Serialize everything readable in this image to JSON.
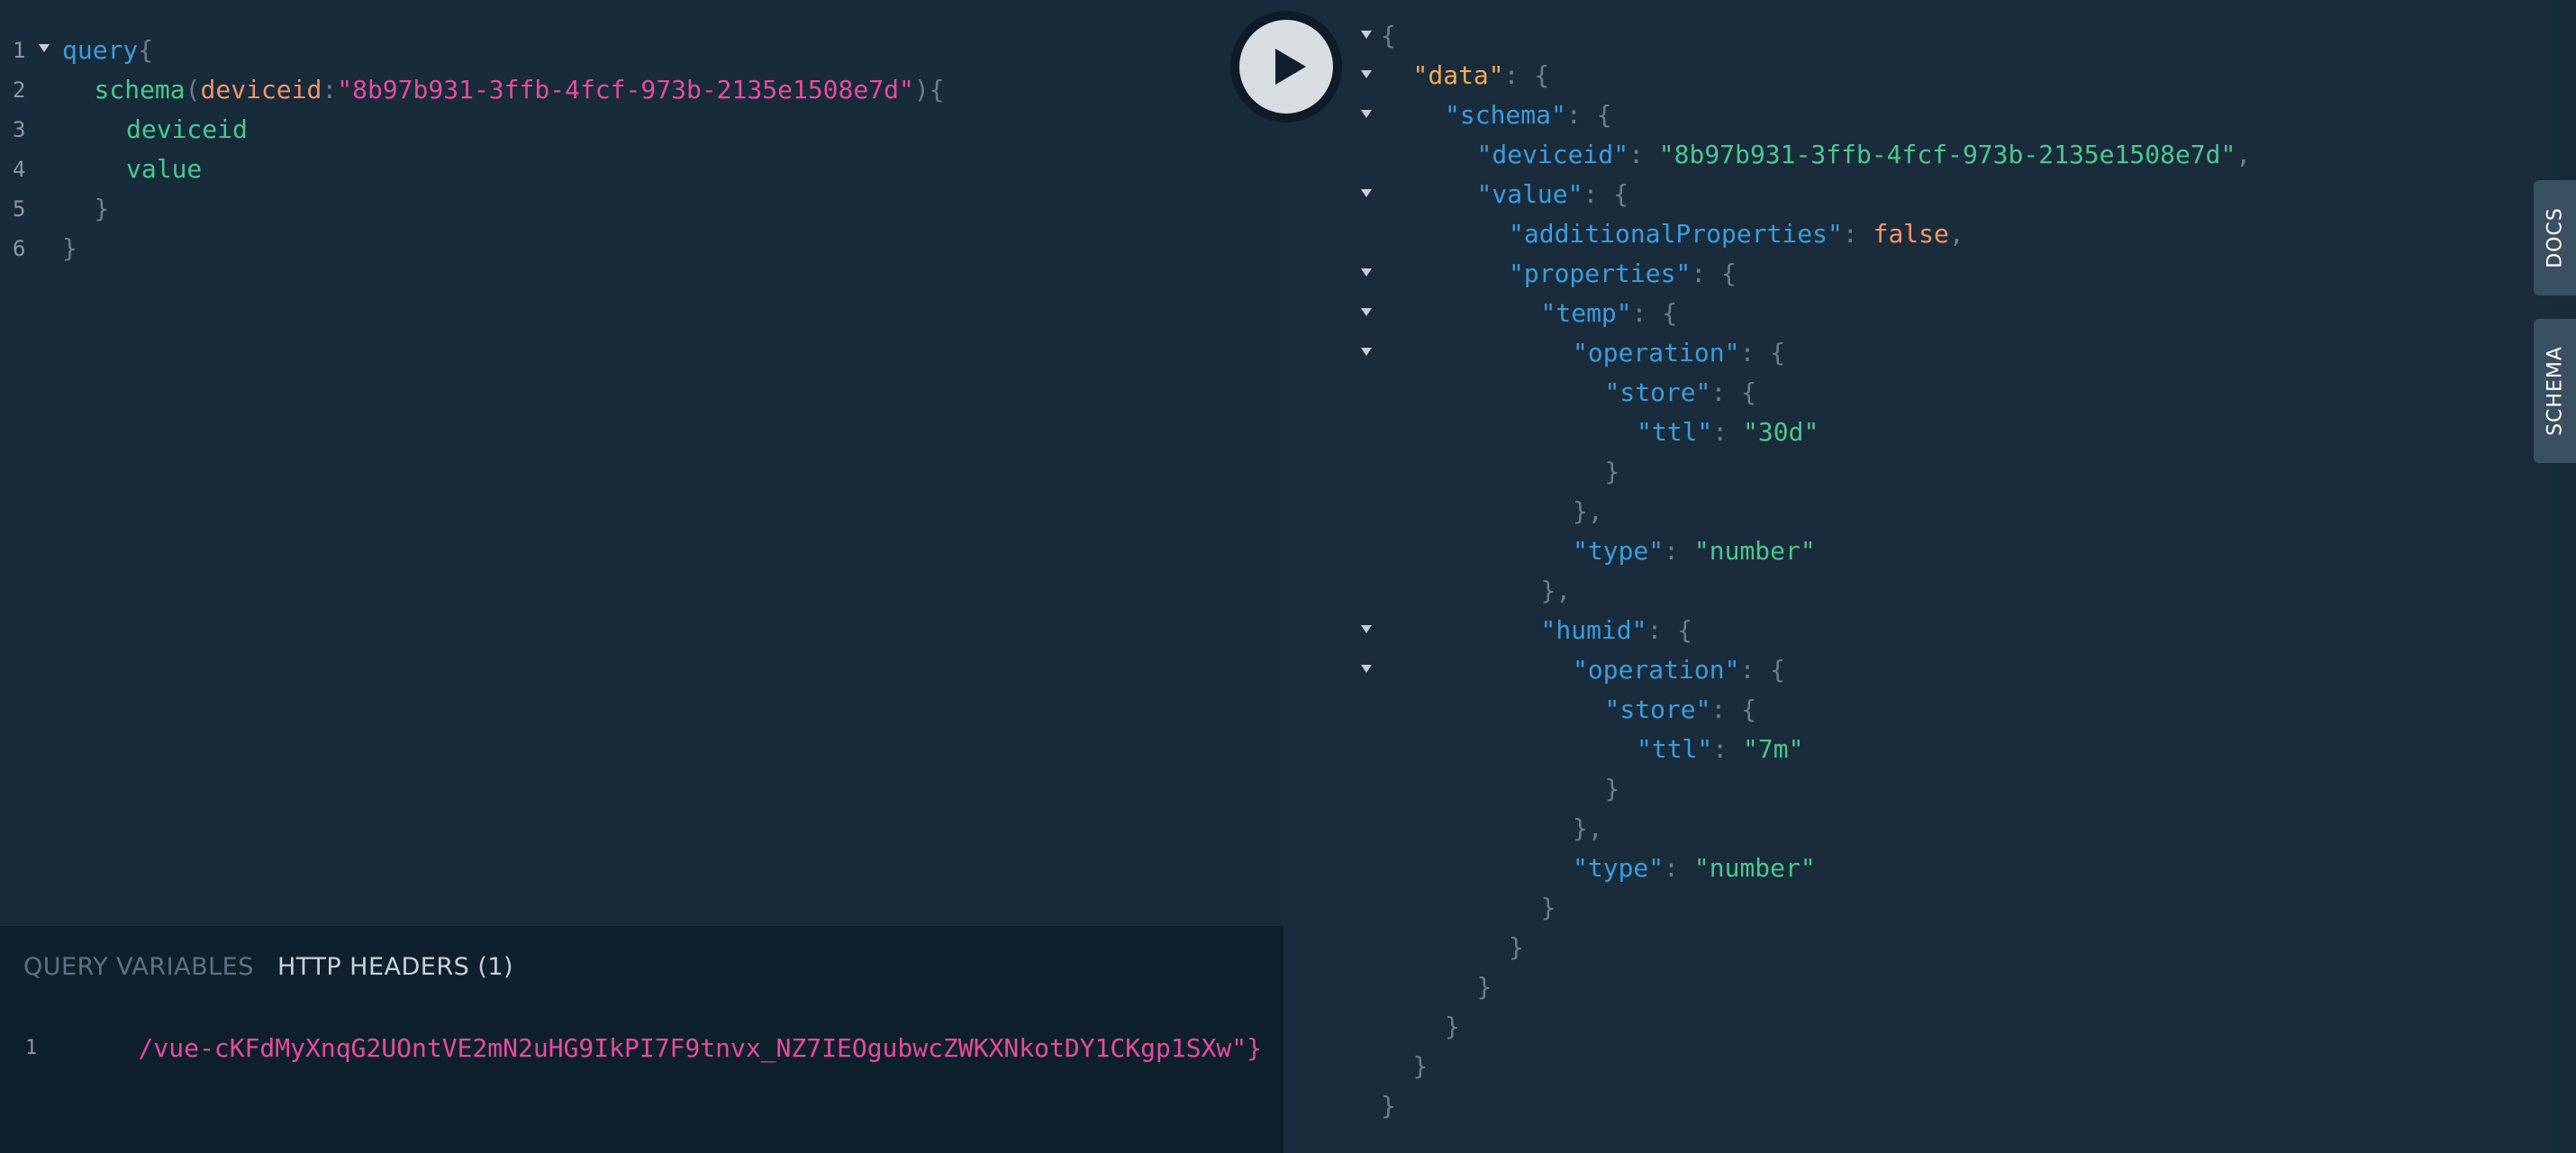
{
  "editor": {
    "lines": [
      {
        "num": "1",
        "fold": true,
        "indent": 0,
        "tokens": [
          {
            "t": "query",
            "c": "keyword"
          },
          {
            "t": "{",
            "c": "punct"
          }
        ]
      },
      {
        "num": "2",
        "fold": false,
        "indent": 1,
        "tokens": [
          {
            "t": "schema",
            "c": "field"
          },
          {
            "t": "(",
            "c": "punct"
          },
          {
            "t": "deviceid",
            "c": "arg"
          },
          {
            "t": ":",
            "c": "punct"
          },
          {
            "t": "\"8b97b931-3ffb-4fcf-973b-2135e1508e7d\"",
            "c": "str"
          },
          {
            "t": "){",
            "c": "punct"
          }
        ]
      },
      {
        "num": "3",
        "fold": false,
        "indent": 2,
        "tokens": [
          {
            "t": "deviceid",
            "c": "field"
          }
        ]
      },
      {
        "num": "4",
        "fold": false,
        "indent": 2,
        "tokens": [
          {
            "t": "value",
            "c": "field"
          }
        ]
      },
      {
        "num": "5",
        "fold": false,
        "indent": 1,
        "tokens": [
          {
            "t": "}",
            "c": "punct"
          }
        ]
      },
      {
        "num": "6",
        "fold": false,
        "indent": 0,
        "tokens": [
          {
            "t": "}",
            "c": "punct"
          }
        ]
      }
    ]
  },
  "variables_panel": {
    "tab_query_variables": "QUERY VARIABLES",
    "tab_http_headers": "HTTP HEADERS (1)",
    "line_num": "1",
    "value": "/vue-cKFdMyXnqG2UOntVE2mN2uHG9IkPI7F9tnvx_NZ7IEOgubwcZWKXNkotDY1CKgp1SXw\"}"
  },
  "run_button": {
    "icon": "play-icon"
  },
  "side_tabs": {
    "docs": "DOCS",
    "schema": "SCHEMA"
  },
  "result": {
    "lines": [
      {
        "fold": true,
        "indent": 0,
        "tokens": [
          {
            "t": "{",
            "c": "punct"
          }
        ]
      },
      {
        "fold": true,
        "indent": 1,
        "tokens": [
          {
            "t": "\"data\"",
            "c": "key-data"
          },
          {
            "t": ": {",
            "c": "punct"
          }
        ]
      },
      {
        "fold": true,
        "indent": 2,
        "tokens": [
          {
            "t": "\"schema\"",
            "c": "key"
          },
          {
            "t": ": {",
            "c": "punct"
          }
        ]
      },
      {
        "fold": false,
        "indent": 3,
        "tokens": [
          {
            "t": "\"deviceid\"",
            "c": "key"
          },
          {
            "t": ": ",
            "c": "punct"
          },
          {
            "t": "\"8b97b931-3ffb-4fcf-973b-2135e1508e7d\"",
            "c": "str"
          },
          {
            "t": ",",
            "c": "punct"
          }
        ]
      },
      {
        "fold": true,
        "indent": 3,
        "tokens": [
          {
            "t": "\"value\"",
            "c": "key"
          },
          {
            "t": ": {",
            "c": "punct"
          }
        ]
      },
      {
        "fold": false,
        "indent": 4,
        "tokens": [
          {
            "t": "\"additionalProperties\"",
            "c": "key"
          },
          {
            "t": ": ",
            "c": "punct"
          },
          {
            "t": "false",
            "c": "bool"
          },
          {
            "t": ",",
            "c": "punct"
          }
        ]
      },
      {
        "fold": true,
        "indent": 4,
        "tokens": [
          {
            "t": "\"properties\"",
            "c": "key"
          },
          {
            "t": ": {",
            "c": "punct"
          }
        ]
      },
      {
        "fold": true,
        "indent": 5,
        "tokens": [
          {
            "t": "\"temp\"",
            "c": "key"
          },
          {
            "t": ": {",
            "c": "punct"
          }
        ]
      },
      {
        "fold": true,
        "indent": 6,
        "tokens": [
          {
            "t": "\"operation\"",
            "c": "key"
          },
          {
            "t": ": {",
            "c": "punct"
          }
        ]
      },
      {
        "fold": false,
        "indent": 7,
        "tokens": [
          {
            "t": "\"store\"",
            "c": "key"
          },
          {
            "t": ": {",
            "c": "punct"
          }
        ]
      },
      {
        "fold": false,
        "indent": 8,
        "tokens": [
          {
            "t": "\"ttl\"",
            "c": "key"
          },
          {
            "t": ": ",
            "c": "punct"
          },
          {
            "t": "\"30d\"",
            "c": "str"
          }
        ]
      },
      {
        "fold": false,
        "indent": 7,
        "tokens": [
          {
            "t": "}",
            "c": "punct"
          }
        ]
      },
      {
        "fold": false,
        "indent": 6,
        "tokens": [
          {
            "t": "},",
            "c": "punct"
          }
        ]
      },
      {
        "fold": false,
        "indent": 6,
        "tokens": [
          {
            "t": "\"type\"",
            "c": "key"
          },
          {
            "t": ": ",
            "c": "punct"
          },
          {
            "t": "\"number\"",
            "c": "str"
          }
        ]
      },
      {
        "fold": false,
        "indent": 5,
        "tokens": [
          {
            "t": "},",
            "c": "punct"
          }
        ]
      },
      {
        "fold": true,
        "indent": 5,
        "tokens": [
          {
            "t": "\"humid\"",
            "c": "key"
          },
          {
            "t": ": {",
            "c": "punct"
          }
        ]
      },
      {
        "fold": true,
        "indent": 6,
        "tokens": [
          {
            "t": "\"operation\"",
            "c": "key"
          },
          {
            "t": ": {",
            "c": "punct"
          }
        ]
      },
      {
        "fold": false,
        "indent": 7,
        "tokens": [
          {
            "t": "\"store\"",
            "c": "key"
          },
          {
            "t": ": {",
            "c": "punct"
          }
        ]
      },
      {
        "fold": false,
        "indent": 8,
        "tokens": [
          {
            "t": "\"ttl\"",
            "c": "key"
          },
          {
            "t": ": ",
            "c": "punct"
          },
          {
            "t": "\"7m\"",
            "c": "str"
          }
        ]
      },
      {
        "fold": false,
        "indent": 7,
        "tokens": [
          {
            "t": "}",
            "c": "punct"
          }
        ]
      },
      {
        "fold": false,
        "indent": 6,
        "tokens": [
          {
            "t": "},",
            "c": "punct"
          }
        ]
      },
      {
        "fold": false,
        "indent": 6,
        "tokens": [
          {
            "t": "\"type\"",
            "c": "key"
          },
          {
            "t": ": ",
            "c": "punct"
          },
          {
            "t": "\"number\"",
            "c": "str"
          }
        ]
      },
      {
        "fold": false,
        "indent": 5,
        "tokens": [
          {
            "t": "}",
            "c": "punct"
          }
        ]
      },
      {
        "fold": false,
        "indent": 4,
        "tokens": [
          {
            "t": "}",
            "c": "punct"
          }
        ]
      },
      {
        "fold": false,
        "indent": 3,
        "tokens": [
          {
            "t": "}",
            "c": "punct"
          }
        ]
      },
      {
        "fold": false,
        "indent": 2,
        "tokens": [
          {
            "t": "}",
            "c": "punct"
          }
        ]
      },
      {
        "fold": false,
        "indent": 1,
        "tokens": [
          {
            "t": "}",
            "c": "punct"
          }
        ]
      },
      {
        "fold": false,
        "indent": 0,
        "tokens": [
          {
            "t": "}",
            "c": "punct"
          }
        ]
      }
    ]
  }
}
